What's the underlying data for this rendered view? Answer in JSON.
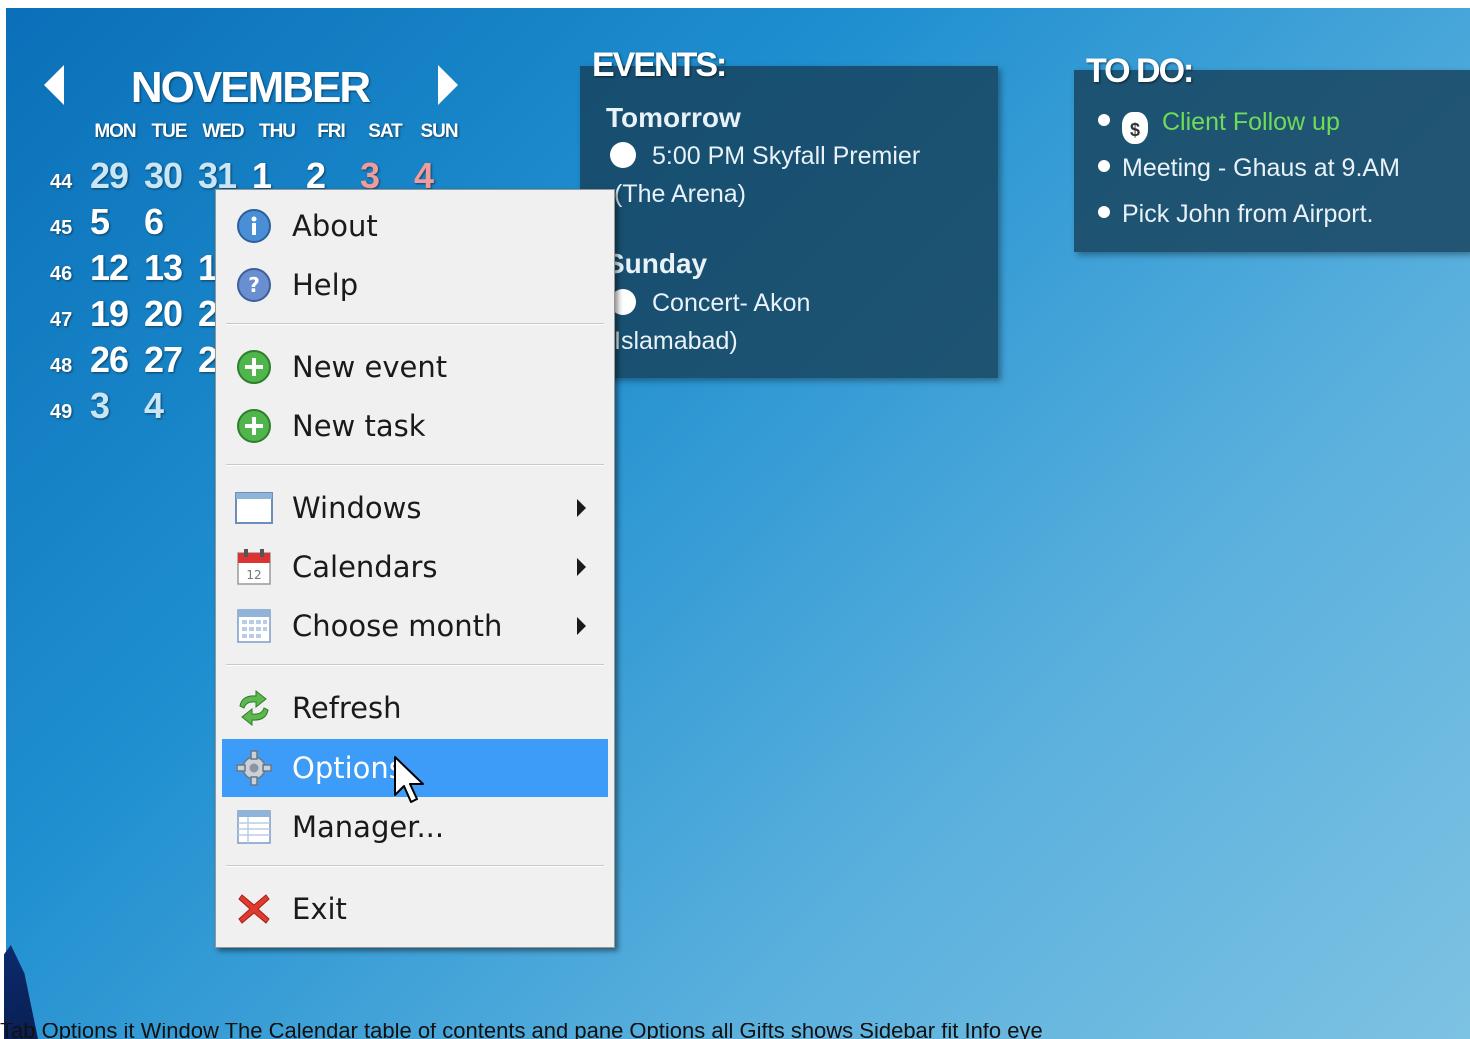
{
  "calendar": {
    "month": "NOVEMBER",
    "weekdays": [
      "MON",
      "TUE",
      "WED",
      "THU",
      "FRI",
      "SAT",
      "SUN"
    ],
    "weeks": [
      {
        "number": "44",
        "days": [
          "29",
          "30",
          "31",
          "1",
          "2",
          "3",
          "4"
        ]
      },
      {
        "number": "45",
        "days": [
          "5",
          "6"
        ]
      },
      {
        "number": "46",
        "days": [
          "12",
          "13",
          "1"
        ]
      },
      {
        "number": "47",
        "days": [
          "19",
          "20",
          "2"
        ]
      },
      {
        "number": "48",
        "days": [
          "26",
          "27",
          "2"
        ]
      },
      {
        "number": "49",
        "days": [
          "3",
          "4"
        ]
      }
    ]
  },
  "events": {
    "title": "EVENTS:",
    "groups": [
      {
        "day": "Tomorrow",
        "lines": [
          "5:00 PM Skyfall Premier",
          "(The Arena)"
        ]
      },
      {
        "day": "Sunday",
        "lines": [
          "Concert- Akon",
          "Islamabad)"
        ]
      }
    ]
  },
  "todo": {
    "title": "TO DO:",
    "items": [
      {
        "text": "Client Follow up",
        "color": "#6fdc57"
      },
      {
        "text": "Meeting - Ghaus at 9.AM"
      },
      {
        "text": "Pick John from Airport."
      }
    ]
  },
  "menu": {
    "items": [
      {
        "label": "About",
        "icon": "info-icon"
      },
      {
        "label": "Help",
        "icon": "help-icon"
      },
      {
        "label": "New event",
        "icon": "plus-icon"
      },
      {
        "label": "New task",
        "icon": "plus-icon"
      },
      {
        "label": "Windows",
        "icon": "window-icon"
      },
      {
        "label": "Calendars",
        "icon": "calendar-icon"
      },
      {
        "label": "Choose month",
        "icon": "month-grid-icon"
      },
      {
        "label": "Refresh",
        "icon": "refresh-icon"
      },
      {
        "label": "Options",
        "icon": "gear-icon"
      },
      {
        "label": "Manager...",
        "icon": "table-icon"
      },
      {
        "label": "Exit",
        "icon": "close-icon"
      }
    ],
    "highlighted": "Options",
    "highlight_color": "#3d9cf7"
  },
  "ticker": "Tab Options it Window The Calendar table of contents and pane Options all Gifts shows Sidebar fit Info eye"
}
